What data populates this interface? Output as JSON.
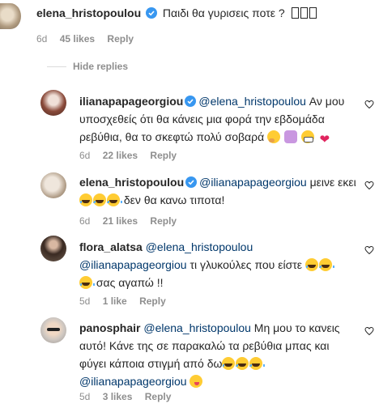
{
  "colors": {
    "text": "#262626",
    "muted": "#8e8e8e",
    "mention": "#00376b",
    "verified": "#3897f0"
  },
  "comments": [
    {
      "username": "elena_hristopoulou",
      "text": "Παιδι θα γυρισεις ποτε ?",
      "time": "6d",
      "likes": "45 likes",
      "reply": "Reply"
    },
    {
      "username": "ilianapapageorgiou",
      "mention": "@elena_hristopoulou",
      "text_l1": "Αν μου",
      "text_l2": "υποσχεθείς ότι θα κάνεις μια φορά την εβδομάδα",
      "text_l3": "ρεβύθια, θα το σκεφτώ πολύ σοβαρά",
      "time": "6d",
      "likes": "22 likes",
      "reply": "Reply"
    },
    {
      "username": "elena_hristopoulou",
      "mention": "@ilianapapageorgiou",
      "text_l1": "μεινε εκει",
      "text_l2": "δεν θα κανω τιποτα!",
      "time": "6d",
      "likes": "21 likes",
      "reply": "Reply"
    },
    {
      "username": "flora_alatsa",
      "mention": "@elena_hristopoulou",
      "mention2": "@ilianapapageorgiou",
      "text_l2": "τι γλυκούλες που είστε",
      "text_l3": "σας αγαπώ !!",
      "time": "5d",
      "likes": "1 like",
      "reply": "Reply"
    },
    {
      "username": "panosphair",
      "mention": "@elena_hristopoulou",
      "text_l1": "Μη μου το κανεις",
      "text_l2": "αυτό! Κάνε της σε παρακαλώ τα ρεβύθια μπας και",
      "text_l3": "φύγει κάποια στιγμή από δω",
      "mention2": "@ilianapapageorgiou",
      "time": "5d",
      "likes": "3 likes",
      "reply": "Reply"
    }
  ],
  "hide_replies": "Hide replies"
}
